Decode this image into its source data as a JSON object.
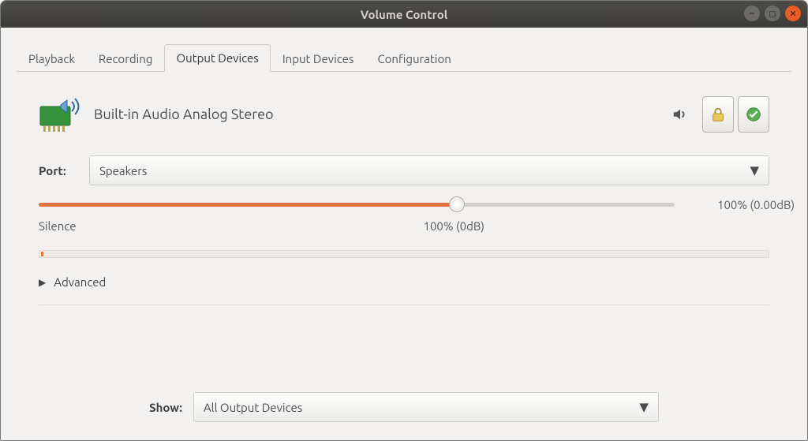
{
  "window": {
    "title": "Volume Control"
  },
  "tabs": [
    "Playback",
    "Recording",
    "Output Devices",
    "Input Devices",
    "Configuration"
  ],
  "active_tab_index": 2,
  "device": {
    "name": "Built-in Audio Analog Stereo",
    "port_label": "Port:",
    "port_value": "Speakers",
    "volume_percent": 100,
    "volume_readout": "100% (0.00dB)",
    "mark_silence": "Silence",
    "mark_100": "100% (0dB)",
    "advanced_label": "Advanced"
  },
  "footer": {
    "show_label": "Show:",
    "show_value": "All Output Devices"
  },
  "icons": {
    "mute": "mute-icon",
    "lock": "lock-icon",
    "default": "check-icon",
    "caret": "▼",
    "expander": "▶"
  }
}
